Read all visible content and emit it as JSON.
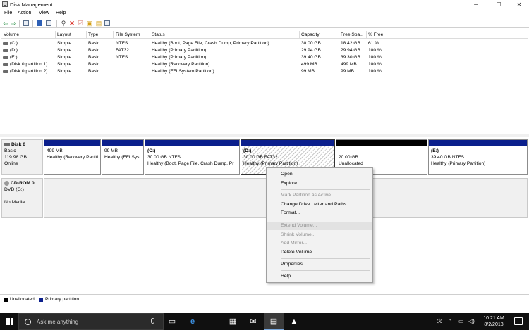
{
  "window": {
    "title": "Disk Management",
    "controls": {
      "minimize": "─",
      "maximize": "☐",
      "close": "✕"
    }
  },
  "menu": [
    "File",
    "Action",
    "View",
    "Help"
  ],
  "toolbar": {
    "icons": [
      "back-arrow-icon",
      "forward-arrow-icon",
      "console-tree-icon",
      "help-icon",
      "properties-icon",
      "connect-icon",
      "delete-icon",
      "check-icon",
      "new-icon",
      "open-icon",
      "view-icon"
    ],
    "colors": {
      "back": "#1f8a3b",
      "delete": "#d9261c",
      "help": "#2d5fb5"
    }
  },
  "volume_table": {
    "columns": [
      "Volume",
      "Layout",
      "Type",
      "File System",
      "Status",
      "Capacity",
      "Free Spa...",
      "% Free"
    ],
    "rows": [
      [
        "(C:)",
        "Simple",
        "Basic",
        "NTFS",
        "Healthy (Boot, Page File, Crash Dump, Primary Partition)",
        "30.00 GB",
        "18.42 GB",
        "61 %"
      ],
      [
        "(D:)",
        "Simple",
        "Basic",
        "FAT32",
        "Healthy (Primary Partition)",
        "29.94 GB",
        "29.94 GB",
        "100 %"
      ],
      [
        "(E:)",
        "Simple",
        "Basic",
        "NTFS",
        "Healthy (Primary Partition)",
        "39.40 GB",
        "39.30 GB",
        "100 %"
      ],
      [
        "(Disk 0 partition 1)",
        "Simple",
        "Basic",
        "",
        "Healthy (Recovery Partition)",
        "499 MB",
        "499 MB",
        "100 %"
      ],
      [
        "(Disk 0 partition 2)",
        "Simple",
        "Basic",
        "",
        "Healthy (EFI System Partition)",
        "99 MB",
        "99 MB",
        "100 %"
      ]
    ]
  },
  "disks": [
    {
      "name": "Disk 0",
      "type": "Basic",
      "size": "119.98 GB",
      "status": "Online",
      "partitions": [
        {
          "label": "",
          "size": "499 MB",
          "status": "Healthy (Recovery Partiti",
          "bar": "primary"
        },
        {
          "label": "",
          "size": "99 MB",
          "status": "Healthy (EFI Syst",
          "bar": "primary"
        },
        {
          "label": "(C:)",
          "size": "30.00 GB NTFS",
          "status": "Healthy (Boot, Page File, Crash Dump, Pr",
          "bar": "primary"
        },
        {
          "label": "(D:)",
          "size": "30.00 GB FAT32",
          "status": "Healthy (Primary Partition)",
          "bar": "primary",
          "selected": true
        },
        {
          "label": "",
          "size": "20.00 GB",
          "status": "Unallocated",
          "bar": "unallocated"
        },
        {
          "label": "(E:)",
          "size": "39.40 GB NTFS",
          "status": "Healthy (Primary Partition)",
          "bar": "primary"
        }
      ]
    },
    {
      "name": "CD-ROM 0",
      "type": "DVD (G:)",
      "size": "",
      "status": "No Media"
    }
  ],
  "legend": [
    {
      "label": "Unallocated",
      "color": "#000000"
    },
    {
      "label": "Primary partition",
      "color": "#0b1f8c"
    }
  ],
  "context_menu": [
    {
      "label": "Open",
      "enabled": true
    },
    {
      "label": "Explore",
      "enabled": true
    },
    {
      "sep": true
    },
    {
      "label": "Mark Partition as Active",
      "enabled": false
    },
    {
      "label": "Change Drive Letter and Paths...",
      "enabled": true
    },
    {
      "label": "Format...",
      "enabled": true
    },
    {
      "sep": true
    },
    {
      "label": "Extend Volume...",
      "enabled": false,
      "hover": true
    },
    {
      "label": "Shrink Volume...",
      "enabled": false
    },
    {
      "label": "Add Mirror...",
      "enabled": false
    },
    {
      "label": "Delete Volume...",
      "enabled": true
    },
    {
      "sep": true
    },
    {
      "label": "Properties",
      "enabled": true
    },
    {
      "sep": true
    },
    {
      "label": "Help",
      "enabled": true
    }
  ],
  "taskbar": {
    "search_placeholder": "Ask me anything",
    "apps": [
      "task-view-icon",
      "edge-icon",
      "store-icon",
      "mail-icon",
      "disk-management-icon",
      "app-icon"
    ],
    "tray": {
      "people": "ℛ",
      "chevron": "^",
      "network": "▭",
      "volume": "◁)"
    },
    "time": "10:21 AM",
    "date": "8/2/2018"
  }
}
